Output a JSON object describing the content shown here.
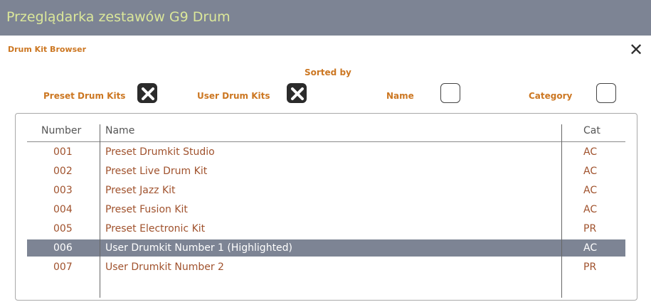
{
  "window": {
    "title": "Przeglądarka zestawów G9 Drum"
  },
  "dialog": {
    "subtitle": "Drum Kit Browser",
    "close_glyph": "✕"
  },
  "filters": {
    "sorted_by_label": "Sorted by",
    "preset_label": "Preset Drum Kits",
    "preset_checked": true,
    "user_label": "User Drum Kits",
    "user_checked": true,
    "name_label": "Name",
    "name_checked": false,
    "category_label": "Category",
    "category_checked": false
  },
  "table": {
    "headers": {
      "number": "Number",
      "name": "Name",
      "cat": "Cat"
    },
    "rows": [
      {
        "number": "001",
        "name": "Preset Drumkit Studio",
        "cat": "AC"
      },
      {
        "number": "002",
        "name": "Preset Live Drum Kit",
        "cat": "AC"
      },
      {
        "number": "003",
        "name": "Preset Jazz Kit",
        "cat": "AC"
      },
      {
        "number": "004",
        "name": "Preset Fusion Kit",
        "cat": "AC"
      },
      {
        "number": "005",
        "name": "Preset Electronic Kit",
        "cat": "PR"
      },
      {
        "number": "006",
        "name": "User Drumkit Number 1 (Highlighted)",
        "cat": "AC",
        "highlighted": true
      },
      {
        "number": "007",
        "name": "User Drumkit Number 2",
        "cat": "PR"
      }
    ]
  },
  "colors": {
    "title_bar": "#7d8494",
    "title_text": "#dbe79a",
    "label_orange": "#cc7722",
    "row_text": "#a0522d",
    "highlight_row": "#7d8494"
  },
  "icons": {
    "close": "close-icon",
    "checked": "x-check-icon"
  }
}
